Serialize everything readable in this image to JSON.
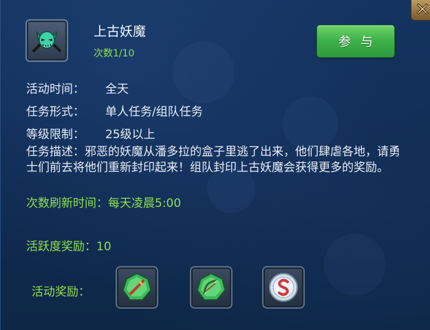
{
  "activity": {
    "name": "上古妖魔",
    "count_text": "次数1/10",
    "join_label": "参与",
    "icon": "demon-mask-icon"
  },
  "info": {
    "time_label": "活动时间：",
    "time_value": "全天",
    "form_label": "任务形式：",
    "form_value": "单人任务/组队任务",
    "level_label": "等级限制：",
    "level_value": "25级以上",
    "description": "任务描述：邪恶的妖魔从潘多拉的盒子里逃了出来，他们肆虐各地，请勇士们前去将他们重新封印起来！组队封印上古妖魔会获得更多的奖励。",
    "refresh": "次数刷新时间：每天凌晨5:00",
    "activity_points": "活跃度奖励：10",
    "reward_label": "活动奖励："
  },
  "rewards": [
    {
      "icon": "green-sword-rune-icon"
    },
    {
      "icon": "green-bow-rune-icon"
    },
    {
      "icon": "silver-coin-s-icon"
    }
  ],
  "colors": {
    "highlight_green": "#8fe04a",
    "button_green": "#3fb34b",
    "background": "#143460"
  }
}
